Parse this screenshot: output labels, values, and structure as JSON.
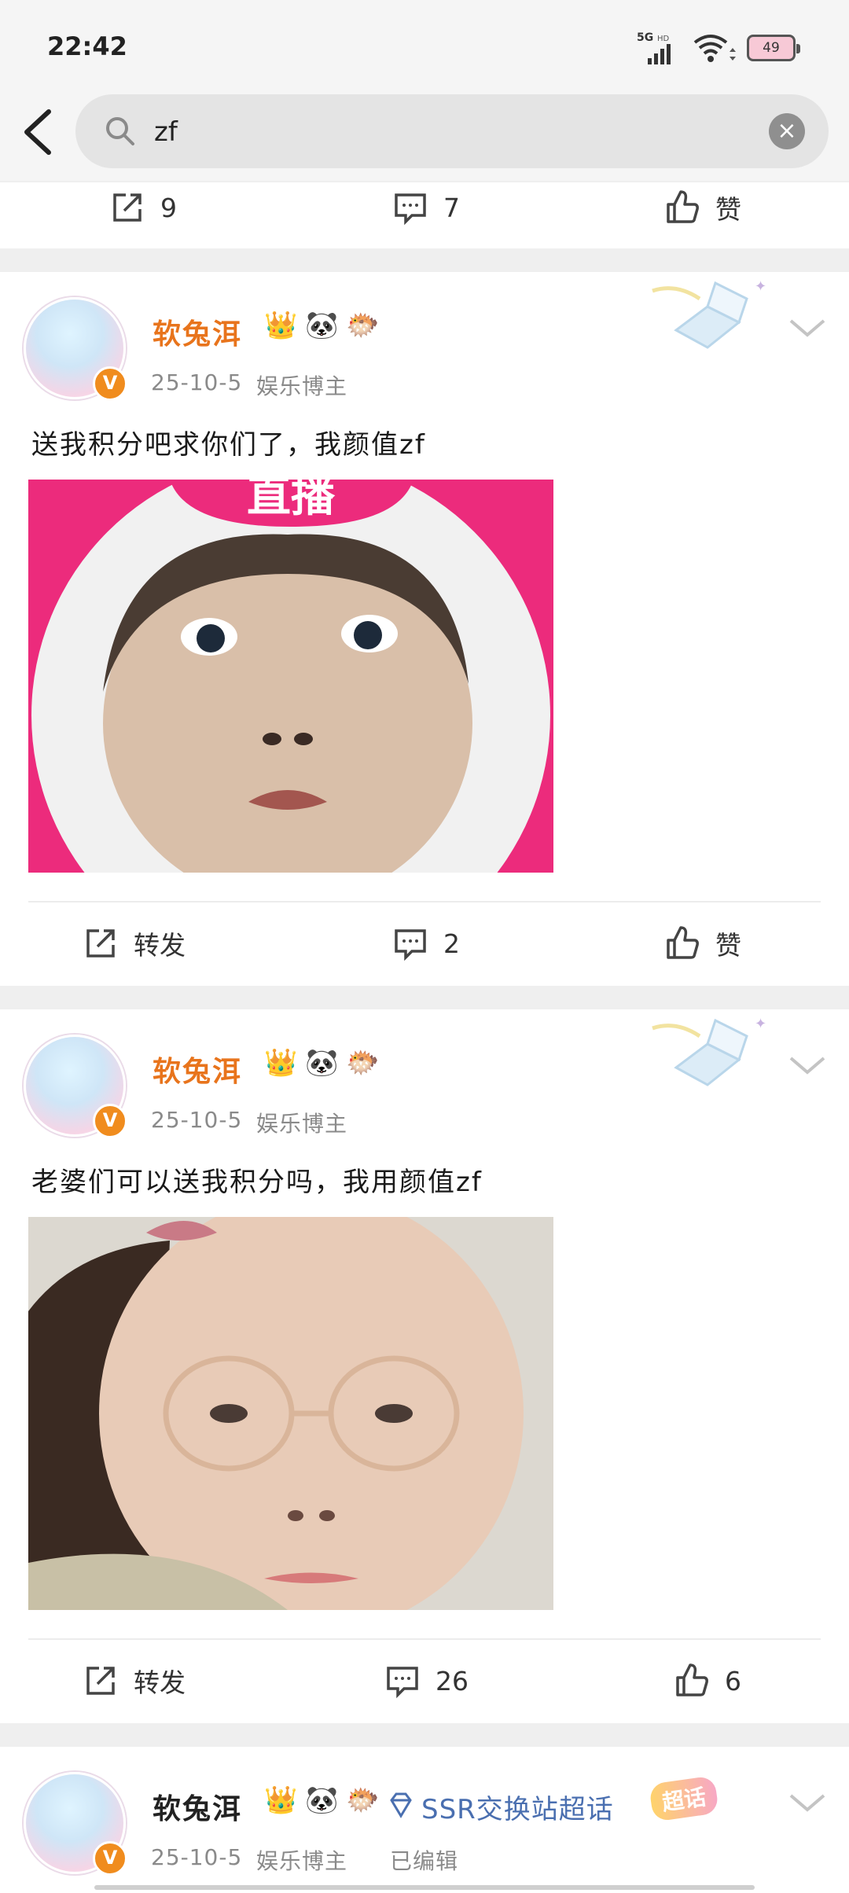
{
  "status": {
    "time": "22:42",
    "network": "5G",
    "hd": "HD",
    "battery": "49"
  },
  "search": {
    "query": "zf"
  },
  "partial_card": {
    "repost_count": "9",
    "comment_count": "7",
    "like_label": "赞"
  },
  "posts": [
    {
      "username": "软兔洱",
      "emoji": [
        "👑",
        "🐼",
        "🐡"
      ],
      "date": "25-10-5",
      "category": "娱乐博主",
      "text": "送我积分吧求你们了，我颜值zf",
      "image_caption": "直播",
      "repost_label": "转发",
      "comment_count": "2",
      "like_label": "赞"
    },
    {
      "username": "软兔洱",
      "emoji": [
        "👑",
        "🐼",
        "🐡"
      ],
      "date": "25-10-5",
      "category": "娱乐博主",
      "text": "老婆们可以送我积分吗，我用颜值zf",
      "repost_label": "转发",
      "comment_count": "26",
      "like_count": "6"
    },
    {
      "username": "软兔洱",
      "emoji": [
        "👑",
        "🐼",
        "🐡"
      ],
      "supertopic": "SSR交换站超话",
      "supertopic_badge": "超话",
      "date": "25-10-5",
      "category": "娱乐博主",
      "edited": "已编辑"
    }
  ],
  "colors": {
    "username": "#e8741c",
    "verified": "#f08c1e",
    "supertopic": "#4a6fb0"
  },
  "icons": [
    "back-arrow-icon",
    "search-icon",
    "clear-icon",
    "repost-icon",
    "comment-icon",
    "like-icon",
    "chevron-down-icon"
  ]
}
